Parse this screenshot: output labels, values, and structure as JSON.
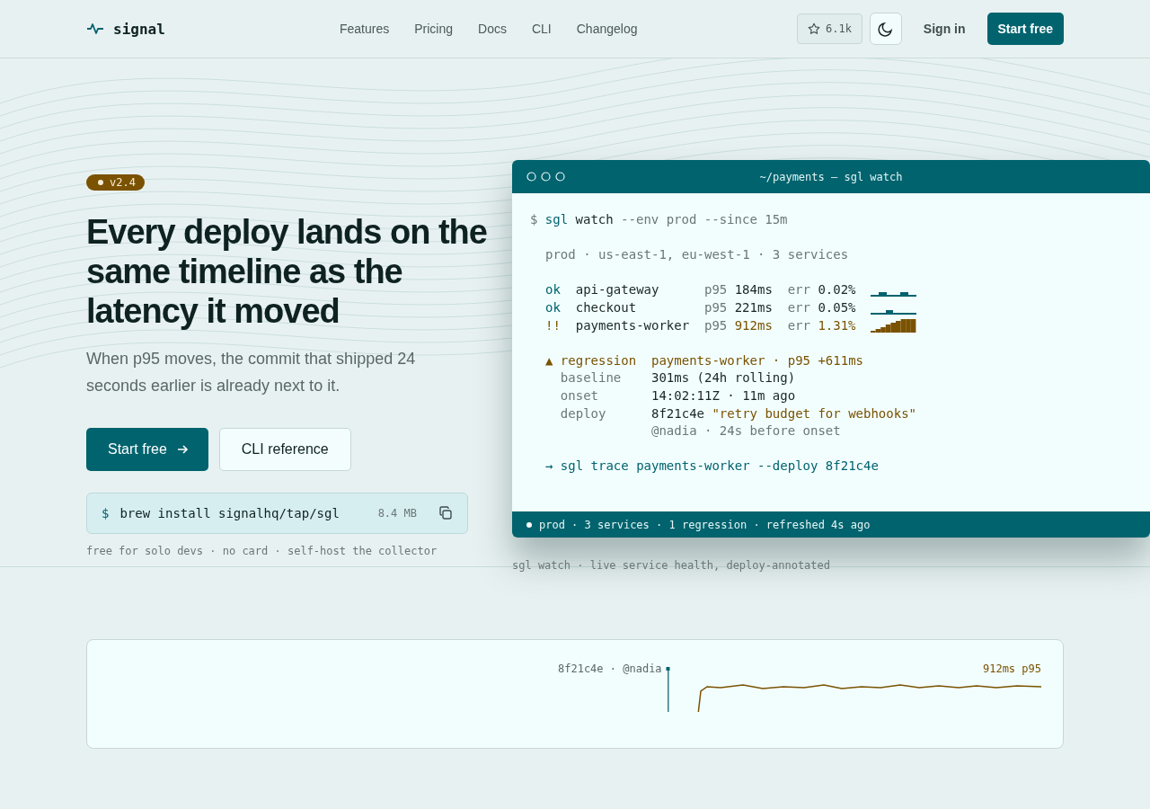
{
  "nav": {
    "logo": "signal",
    "links": [
      {
        "label": "Features"
      },
      {
        "label": "Pricing"
      },
      {
        "label": "Docs"
      },
      {
        "label": "CLI"
      },
      {
        "label": "Changelog"
      }
    ],
    "stars": "6.1k",
    "sign_in": "Sign in",
    "cta": "Start free"
  },
  "hero": {
    "badge": "v2.4",
    "title": "Every deploy lands on the same timeline as the latency it moved",
    "lede": "When p95 moves, the commit that shipped 24 seconds earlier is already next to it.",
    "primary": "Start free",
    "secondary": "CLI reference",
    "install": {
      "prompt": "$",
      "command": "brew install signalhq/tap/sgl",
      "size": "8.4 MB"
    },
    "note": "free for solo devs · no card · self-host the collector"
  },
  "terminal": {
    "title": "~/payments — sgl watch",
    "command": {
      "prompt": "$",
      "program": "sgl",
      "sub": "watch",
      "args": "--env prod --since 15m"
    },
    "scope": "prod · us-east-1, eu-west-1 · 3 services",
    "services": [
      {
        "status": "ok",
        "name": "api-gateway",
        "p95_label": "p95",
        "p95": "184ms",
        "err_label": "err",
        "err": "0.02%",
        "alert": false
      },
      {
        "status": "ok",
        "name": "checkout",
        "p95_label": "p95",
        "p95": "221ms",
        "err_label": "err",
        "err": "0.05%",
        "alert": false
      },
      {
        "status": "!!",
        "name": "payments-worker",
        "p95_label": "p95",
        "p95": "912ms",
        "err_label": "err",
        "err": "1.31%",
        "alert": true
      }
    ],
    "regression": {
      "marker": "▲",
      "label": "regression",
      "summary": "payments-worker · p95 +611ms",
      "details": [
        {
          "label": "baseline",
          "value": "301ms (24h rolling)"
        },
        {
          "label": "onset",
          "value": "14:02:11Z · 11m ago"
        },
        {
          "label": "deploy",
          "value": "8f21c4e",
          "quote": "\"retry budget for webhooks\"",
          "note": "@nadia · 24s before onset"
        }
      ]
    },
    "hint": {
      "arrow": "→",
      "command": "sgl trace payments-worker --deploy 8f21c4e"
    },
    "status": "prod · 3 services · 1 regression · refreshed 4s ago"
  },
  "caption": "sgl watch · live service health, deploy-annotated",
  "chart_card": {
    "deploy_label": "8f21c4e · @nadia",
    "series_label": "912ms p95"
  }
}
